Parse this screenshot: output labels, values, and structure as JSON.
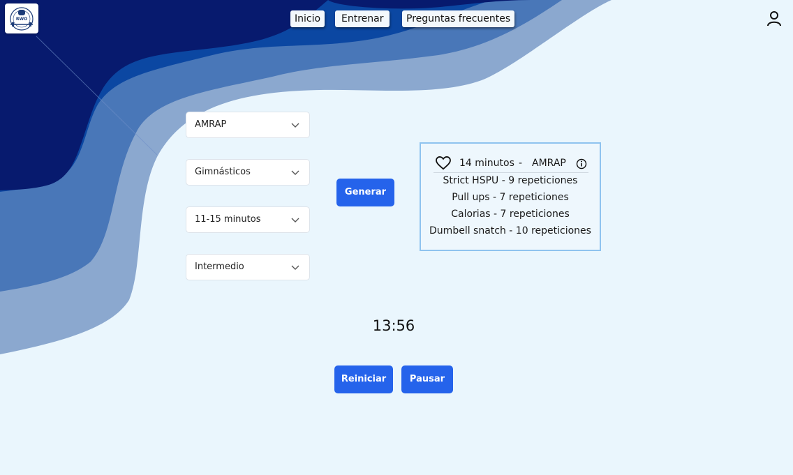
{
  "logo": {
    "text": "RWO"
  },
  "nav": {
    "inicio": "Inicio",
    "entrenar": "Entrenar",
    "faq": "Preguntas frecuentes"
  },
  "icons": {
    "user": "user-icon",
    "favorite": "heart-icon",
    "info": "info-icon",
    "dropdown": "chevron-down-icon"
  },
  "filters": {
    "type": "AMRAP",
    "category": "Gimnásticos",
    "duration": "11-15 minutos",
    "level": "Intermedio"
  },
  "generate_label": "Generar",
  "workout": {
    "time": "14 minutos",
    "separator": "-",
    "type": "AMRAP",
    "exercises": [
      "Strict HSPU - 9 repeticiones",
      "Pull ups - 7 repeticiones",
      "Calorias - 7 repeticiones",
      "Dumbell snatch - 10 repeticiones"
    ]
  },
  "timer": "13:56",
  "controls": {
    "reset": "Reiniciar",
    "pause": "Pausar"
  },
  "colors": {
    "accent": "#2563eb",
    "wave_dark": "#071a6e",
    "wave_mid": "#0b3f9e",
    "wave_light": "#8aa8d0"
  }
}
